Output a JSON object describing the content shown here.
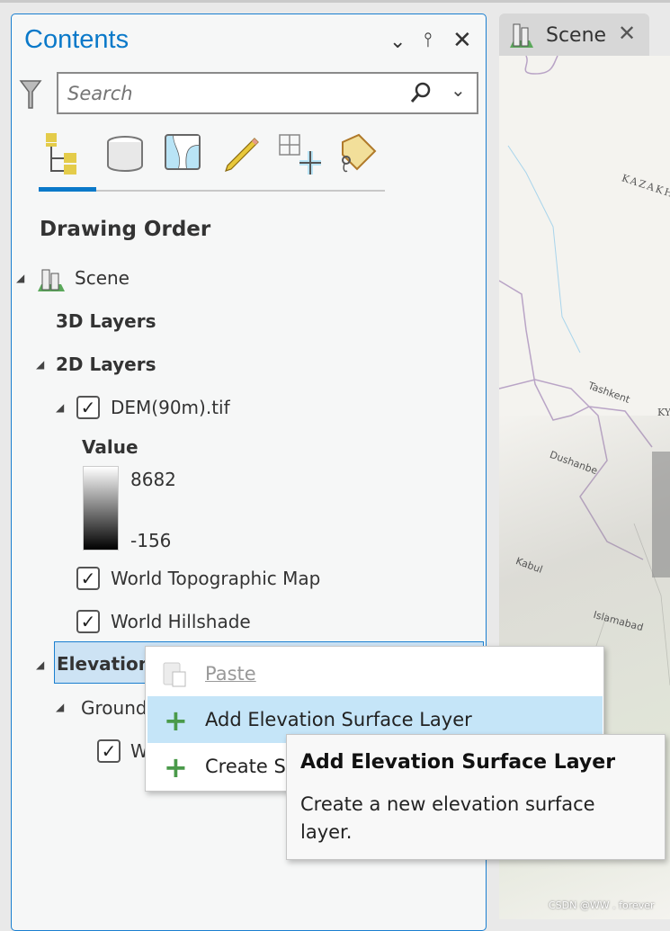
{
  "contents_pane": {
    "title": "Contents",
    "search_placeholder": "Search",
    "section_title": "Drawing Order",
    "toolbar_icons": [
      "list-by-drawing-order-icon",
      "list-by-data-source-icon",
      "list-by-selection-icon",
      "list-by-editing-icon",
      "list-by-snapping-icon",
      "list-by-labeling-icon"
    ],
    "tree": {
      "scene": "Scene",
      "layers3d": "3D Layers",
      "layers2d": "2D Layers",
      "dem": "DEM(90m).tif",
      "legend_title": "Value",
      "legend_max": "8682",
      "legend_min": "-156",
      "topo": "World Topographic Map",
      "hillshade": "World Hillshade",
      "elevation": "Elevation",
      "ground": "Ground",
      "ground_child": "W"
    }
  },
  "view_tab": {
    "label": "Scene"
  },
  "map_labels": [
    "KAZAKHS",
    "Tashkent",
    "KY",
    "Dushanbe",
    "Kabul",
    "Islamabad"
  ],
  "context_menu": {
    "items": [
      {
        "label": "Paste",
        "enabled": false
      },
      {
        "label": "Add Elevation Surface Layer",
        "enabled": true,
        "highlighted": true
      },
      {
        "label": "Create S",
        "enabled": true
      }
    ]
  },
  "tooltip": {
    "title": "Add Elevation Surface Layer",
    "body": "Create a new elevation surface layer."
  },
  "watermark": "CSDN @WW . forever",
  "colors": {
    "accent": "#0a79c9",
    "menu_highlight": "#c5e5f8",
    "plus_green": "#4a9a4a"
  }
}
